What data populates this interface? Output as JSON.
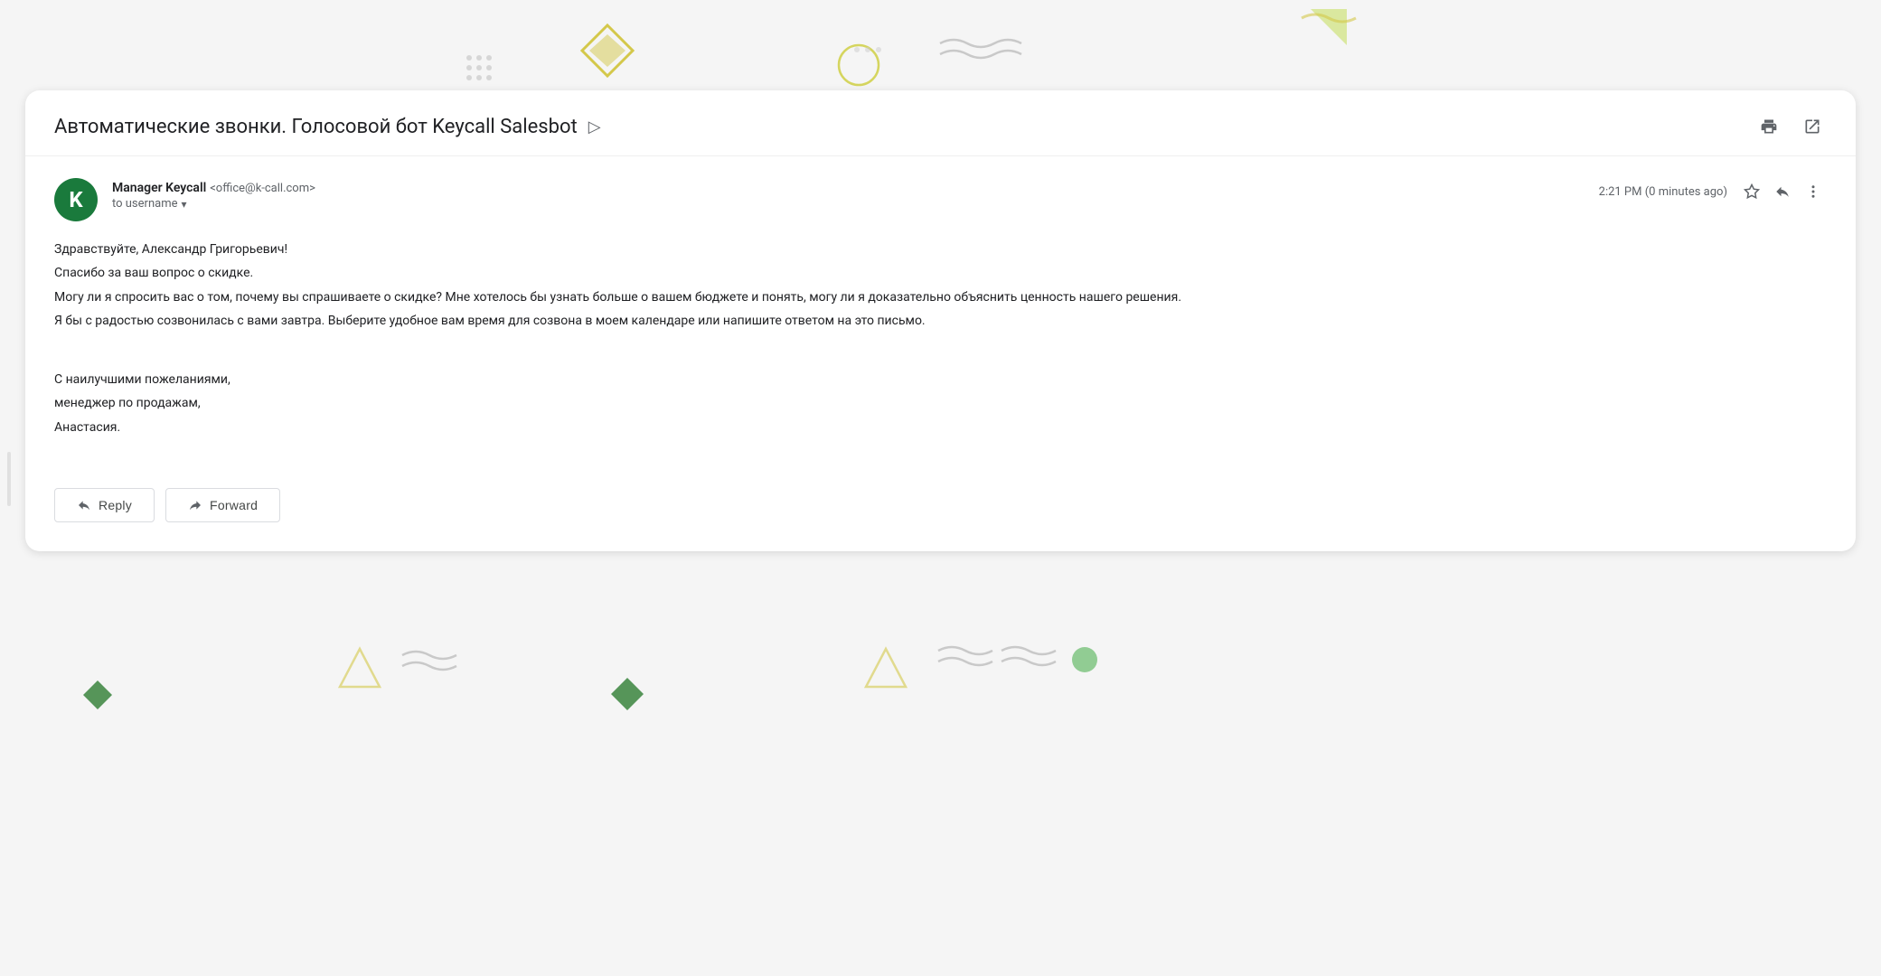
{
  "subject": {
    "text": "Автоматические звонки. Голосовой бот Keycall Salesbot",
    "label_icon": "▷",
    "print_title": "Print",
    "popout_title": "Pop out"
  },
  "message": {
    "sender_name": "Manager Keycall",
    "sender_email": "<office@k-call.com>",
    "to_label": "to username",
    "timestamp": "2:21 PM (0 minutes ago)",
    "body_lines": [
      "Здравствуйте, Александр Григорьевич!",
      "Спасибо за ваш вопрос о скидке.",
      "Могу ли я спросить вас о том, почему вы спрашиваете о скидке? Мне хотелось бы узнать больше о вашем бюджете и понять, могу ли я доказательно объяснить ценность нашего решения.",
      "Я бы с радостью созвонилась с вами завтра. Выберите удобное вам время для созвона в моем календаре или напишите ответом на это письмо.",
      "",
      "С наилучшими пожеланиями,",
      "менеджер по продажам,",
      "Анастасия."
    ]
  },
  "actions": {
    "reply_label": "Reply",
    "forward_label": "Forward"
  }
}
